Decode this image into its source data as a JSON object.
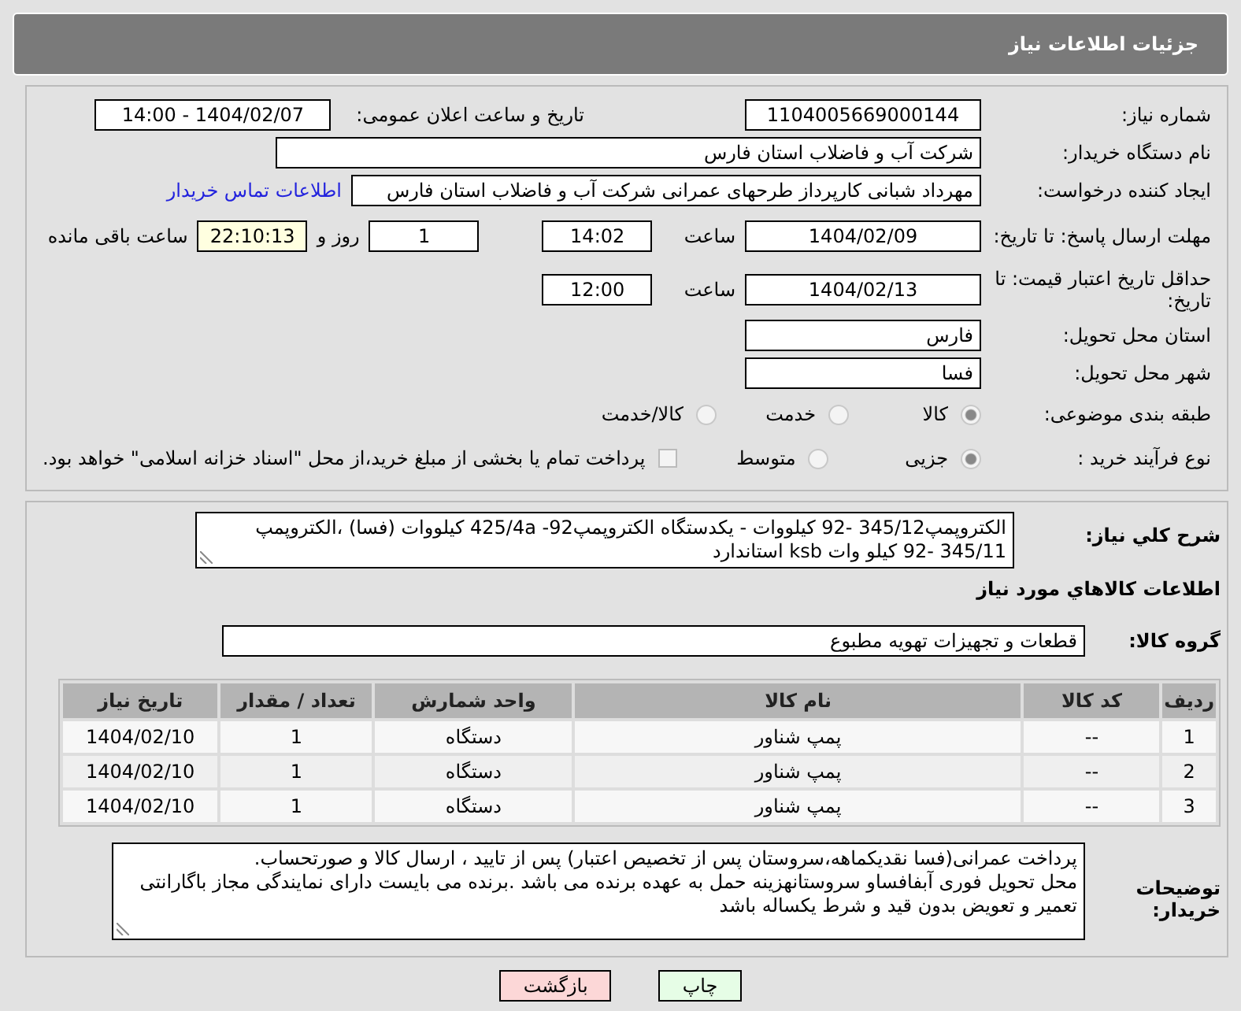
{
  "header": {
    "title": "جزئیات اطلاعات نیاز"
  },
  "details": {
    "need_number": {
      "label": "شماره نیاز:",
      "value": "1104005669000144"
    },
    "announce": {
      "label": "تاریخ و ساعت اعلان عمومی:",
      "value": "1404/02/07 - 14:00"
    },
    "buyer": {
      "label": "نام دستگاه خریدار:",
      "value": "شرکت آب و فاضلاب استان فارس"
    },
    "creator": {
      "label": "ایجاد کننده درخواست:",
      "value": "مهرداد شبانی کارپرداز طرحهای عمرانی  شرکت آب و فاضلاب استان فارس",
      "link": "اطلاعات تماس خریدار"
    },
    "deadline": {
      "label": "مهلت ارسال پاسخ: تا تاریخ:",
      "date": "1404/02/09",
      "time_label": "ساعت",
      "time": "14:02",
      "days": "1",
      "days_label": "روز و",
      "remaining": "22:10:13",
      "remaining_label": "ساعت باقی مانده"
    },
    "validity": {
      "label": "حداقل تاریخ اعتبار قیمت: تا تاریخ:",
      "date": "1404/02/13",
      "time_label": "ساعت",
      "time": "12:00"
    },
    "province": {
      "label": "استان محل تحویل:",
      "value": "فارس"
    },
    "city": {
      "label": "شهر محل تحویل:",
      "value": "فسا"
    },
    "category": {
      "label": "طبقه بندی موضوعی:",
      "options": [
        {
          "label": "کالا",
          "selected": true
        },
        {
          "label": "خدمت",
          "selected": false
        },
        {
          "label": "کالا/خدمت",
          "selected": false
        }
      ]
    },
    "process": {
      "label": "نوع فرآیند خرید :",
      "options": [
        {
          "label": "جزیی",
          "selected": true
        },
        {
          "label": "متوسط",
          "selected": false
        }
      ],
      "payment": {
        "checked": false,
        "label": "پرداخت تمام یا بخشی از مبلغ خرید،از محل \"اسناد خزانه اسلامی\" خواهد بود."
      }
    }
  },
  "summary": {
    "label": "شرح کلي نياز:",
    "value": "الکتروپمپ345/12 -92 کیلووات - یکدستگاه  الکتروپمپ92- 425/4a کیلووات (فسا) ،الکتروپمپ 345/11 -92 کیلو وات  ksb استاندارد"
  },
  "goods": {
    "title": "اطلاعات کالاهاي مورد نياز",
    "group_label": "گروه کالا:",
    "group": "قطعات و تجهیزات تهویه مطبوع",
    "columns": [
      "رديف",
      "کد کالا",
      "نام کالا",
      "واحد شمارش",
      "تعداد / مقدار",
      "تاريخ نياز"
    ],
    "rows": [
      [
        "1",
        "--",
        "پمپ شناور",
        "دستگاه",
        "1",
        "1404/02/10"
      ],
      [
        "2",
        "--",
        "پمپ شناور",
        "دستگاه",
        "1",
        "1404/02/10"
      ],
      [
        "3",
        "--",
        "پمپ شناور",
        "دستگاه",
        "1",
        "1404/02/10"
      ]
    ]
  },
  "notes": {
    "label": "توضیحات خریدار:",
    "lines": [
      "پرداخت عمرانی(فسا نقدیکماهه،سروستان پس از تخصیص اعتبار) پس از تایید ، ارسال کالا  و صورتحساب.",
      "محل تحویل فوری آبفافساو سروستانهزینه حمل به عهده برنده می باشد .برنده می بایست دارای نمایندگی مجاز باگارانتی تعمیر و تعویض بدون قید و شرط یکساله باشد"
    ]
  },
  "buttons": [
    {
      "kind": "print",
      "label": "چاپ"
    },
    {
      "kind": "back",
      "label": "بازگشت"
    }
  ]
}
